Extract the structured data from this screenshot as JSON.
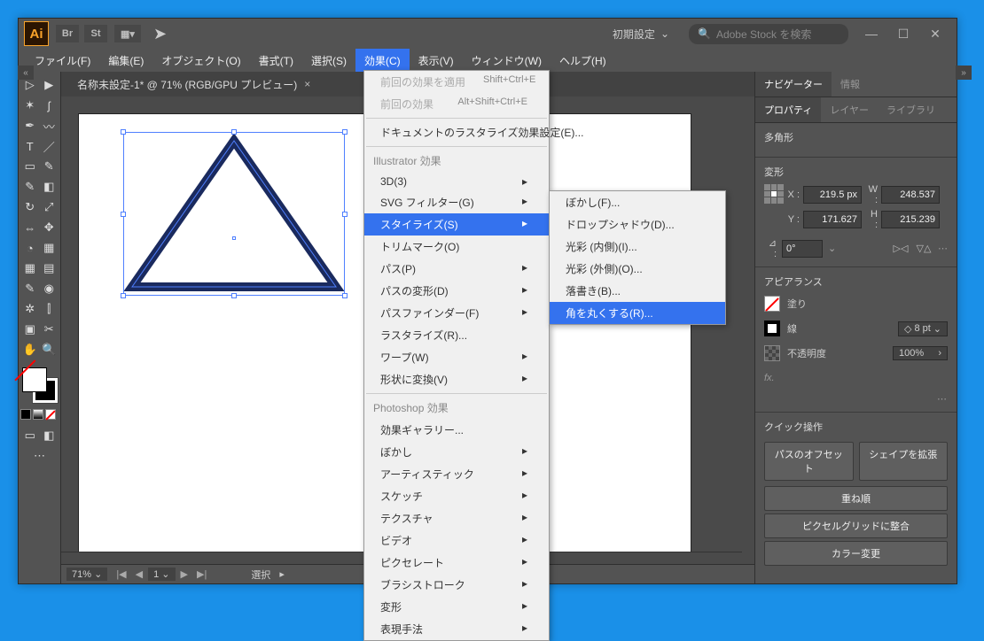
{
  "titlebar": {
    "logo": "Ai",
    "icons": [
      "Br",
      "St"
    ],
    "workspace": "初期設定",
    "search_placeholder": "Adobe Stock を検索"
  },
  "menubar": {
    "items": [
      "ファイル(F)",
      "編集(E)",
      "オブジェクト(O)",
      "書式(T)",
      "選択(S)",
      "効果(C)",
      "表示(V)",
      "ウィンドウ(W)",
      "ヘルプ(H)"
    ],
    "activeIndex": 5
  },
  "doc_tab": {
    "title": "名称未設定-1* @ 71% (RGB/GPU プレビュー)"
  },
  "effects_menu": {
    "apply_last": "前回の効果を適用",
    "apply_last_sc": "Shift+Ctrl+E",
    "last_effect": "前回の効果",
    "last_effect_sc": "Alt+Shift+Ctrl+E",
    "raster_settings": "ドキュメントのラスタライズ効果設定(E)...",
    "illustrator_header": "Illustrator 効果",
    "il_items": [
      "3D(3)",
      "SVG フィルター(G)",
      "スタイライズ(S)",
      "トリムマーク(O)",
      "パス(P)",
      "パスの変形(D)",
      "パスファインダー(F)",
      "ラスタライズ(R)...",
      "ワープ(W)",
      "形状に変換(V)"
    ],
    "il_highlight": 2,
    "photoshop_header": "Photoshop 効果",
    "ps_items": [
      "効果ギャラリー...",
      "ぼかし",
      "アーティスティック",
      "スケッチ",
      "テクスチャ",
      "ビデオ",
      "ピクセレート",
      "ブラシストローク",
      "変形",
      "表現手法"
    ]
  },
  "stylize_submenu": {
    "items": [
      "ぼかし(F)...",
      "ドロップシャドウ(D)...",
      "光彩 (内側)(I)...",
      "光彩 (外側)(O)...",
      "落書き(B)...",
      "角を丸くする(R)..."
    ],
    "highlight": 5
  },
  "right_panel": {
    "tabsets": [
      {
        "tabs": [
          "ナビゲーター",
          "情報"
        ],
        "active": 0
      },
      {
        "tabs": [
          "プロパティ",
          "レイヤー",
          "ライブラリ"
        ],
        "active": 0
      }
    ],
    "selection_type": "多角形",
    "transform_title": "変形",
    "x_label": "X :",
    "x_val": "219.5 px",
    "y_label": "Y :",
    "y_val": "171.627",
    "w_label": "W :",
    "w_val": "248.537",
    "h_label": "H :",
    "h_val": "215.239",
    "rot_label": "⊿ :",
    "rot_val": "0°",
    "appearance_title": "アピアランス",
    "fill_label": "塗り",
    "stroke_label": "線",
    "stroke_val": "8 pt",
    "opacity_label": "不透明度",
    "opacity_val": "100%",
    "fx_label": "fx.",
    "quick_title": "クイック操作",
    "quick_buttons": [
      "パスのオフセット",
      "シェイプを拡張",
      "重ね順",
      "ピクセルグリッドに整合",
      "カラー変更"
    ]
  },
  "statusbar": {
    "zoom": "71%",
    "page": "1",
    "tool": "選択"
  }
}
